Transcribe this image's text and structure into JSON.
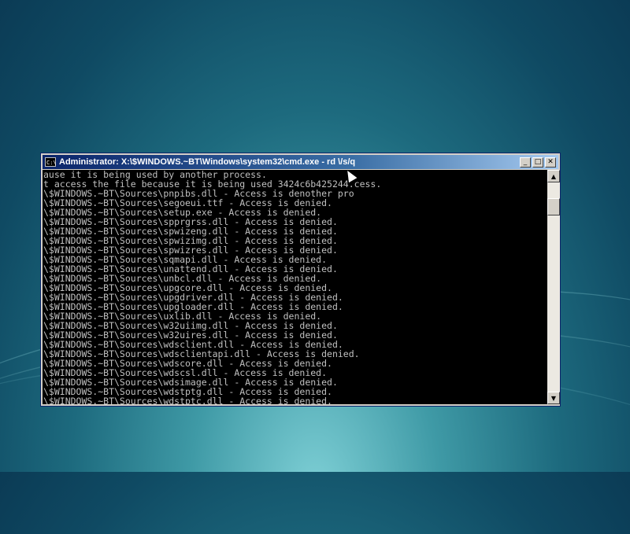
{
  "window": {
    "title": "Administrator: X:\\$WINDOWS.~BT\\Windows\\system32\\cmd.exe - rd \\/s/q",
    "icon_label": "C:\\",
    "minimize_glyph": "_",
    "maximize_glyph": "□",
    "close_glyph": "✕",
    "scroll_up_glyph": "▲",
    "scroll_down_glyph": "▼"
  },
  "console": {
    "lines": [
      "ause it is being used by another process.",
      "t access the file because it is being used 3424c6b425244.cess.",
      "\\$WINDOWS.~BT\\Sources\\pnpibs.dll - Access is denother pro",
      "\\$WINDOWS.~BT\\Sources\\segoeui.ttf - Access is denied.",
      "\\$WINDOWS.~BT\\Sources\\setup.exe - Access is denied.",
      "\\$WINDOWS.~BT\\Sources\\spprgrss.dll - Access is denied.",
      "\\$WINDOWS.~BT\\Sources\\spwizeng.dll - Access is denied.",
      "\\$WINDOWS.~BT\\Sources\\spwizimg.dll - Access is denied.",
      "\\$WINDOWS.~BT\\Sources\\spwizres.dll - Access is denied.",
      "\\$WINDOWS.~BT\\Sources\\sqmapi.dll - Access is denied.",
      "\\$WINDOWS.~BT\\Sources\\unattend.dll - Access is denied.",
      "\\$WINDOWS.~BT\\Sources\\unbcl.dll - Access is denied.",
      "\\$WINDOWS.~BT\\Sources\\upgcore.dll - Access is denied.",
      "\\$WINDOWS.~BT\\Sources\\upgdriver.dll - Access is denied.",
      "\\$WINDOWS.~BT\\Sources\\upgloader.dll - Access is denied.",
      "\\$WINDOWS.~BT\\Sources\\uxlib.dll - Access is denied.",
      "\\$WINDOWS.~BT\\Sources\\w32uiimg.dll - Access is denied.",
      "\\$WINDOWS.~BT\\Sources\\w32uires.dll - Access is denied.",
      "\\$WINDOWS.~BT\\Sources\\wdsclient.dll - Access is denied.",
      "\\$WINDOWS.~BT\\Sources\\wdsclientapi.dll - Access is denied.",
      "\\$WINDOWS.~BT\\Sources\\wdscore.dll - Access is denied.",
      "\\$WINDOWS.~BT\\Sources\\wdscsl.dll - Access is denied.",
      "\\$WINDOWS.~BT\\Sources\\wdsimage.dll - Access is denied.",
      "\\$WINDOWS.~BT\\Sources\\wdstptg.dll - Access is denied.",
      "\\$WINDOWS.~BT\\Sources\\wdstptc.dll - Access is denied."
    ]
  }
}
